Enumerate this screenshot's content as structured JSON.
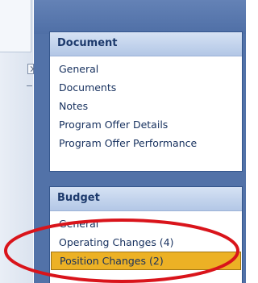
{
  "sidebar": {
    "sections": [
      {
        "title": "Document",
        "items": [
          {
            "label": "General"
          },
          {
            "label": "Documents"
          },
          {
            "label": "Notes"
          },
          {
            "label": "Program Offer Details"
          },
          {
            "label": "Program Offer Performance"
          }
        ]
      },
      {
        "title": "Budget",
        "items": [
          {
            "label": "General"
          },
          {
            "label": "Operating Changes (4)"
          },
          {
            "label": "Position Changes (2)",
            "selected": true
          }
        ]
      }
    ]
  },
  "colors": {
    "sidebar_background": "#5272a8",
    "selected_item": "#ecb125",
    "annotation_ellipse": "#d9141b"
  },
  "icons": {
    "left_strip_icon": "expand-arrow-icon"
  }
}
